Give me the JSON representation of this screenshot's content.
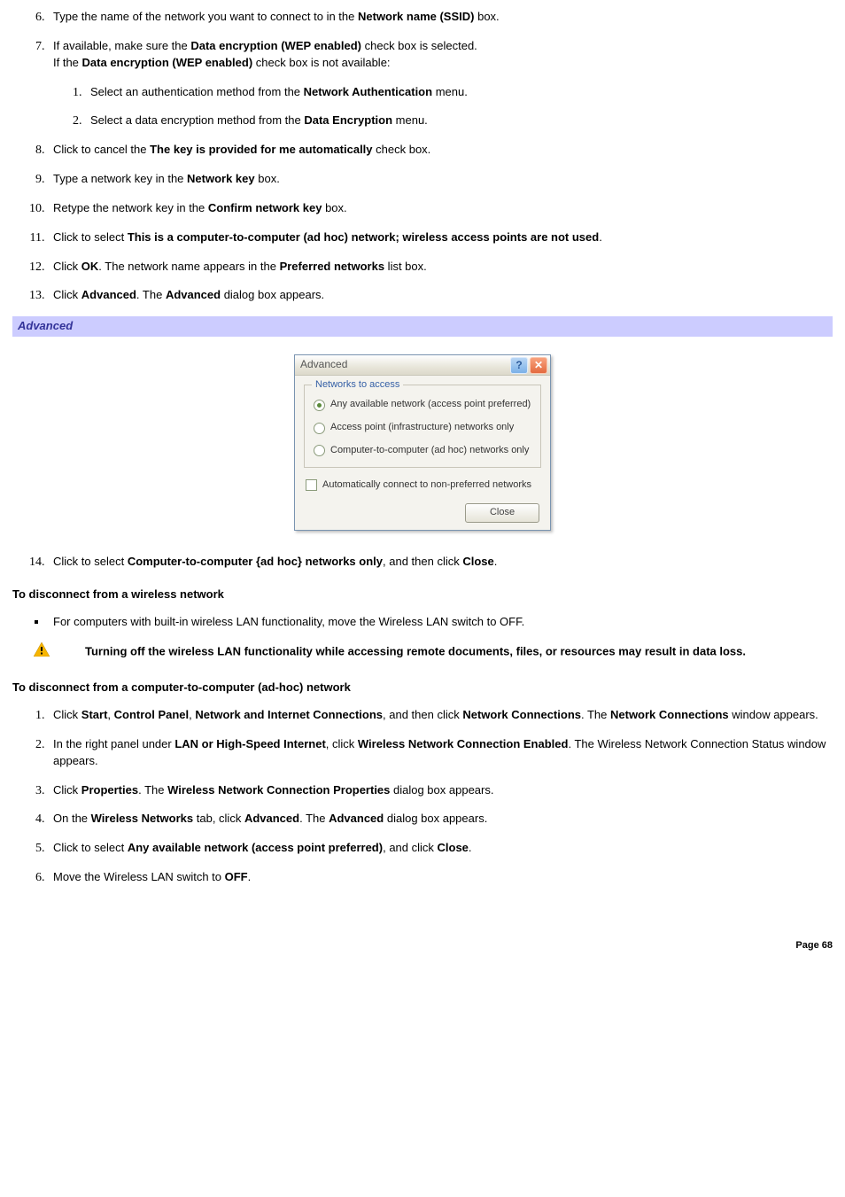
{
  "steps_a": {
    "6": {
      "pre": "Type the name of the network you want to connect to in the ",
      "b1": "Network name (SSID)",
      "post": " box."
    },
    "7": {
      "line1_pre": "If available, make sure the ",
      "line1_b": "Data encryption (WEP enabled)",
      "line1_post": " check box is selected.",
      "line2_pre": "If the ",
      "line2_b": "Data encryption (WEP enabled)",
      "line2_post": " check box is not available:",
      "sub": {
        "1": {
          "pre": "Select an authentication method from the ",
          "b": "Network Authentication",
          "post": " menu."
        },
        "2": {
          "pre": "Select a data encryption method from the ",
          "b": "Data Encryption",
          "post": " menu."
        }
      }
    },
    "8": {
      "pre": "Click to cancel the ",
      "b": "The key is provided for me automatically",
      "post": " check box."
    },
    "9": {
      "pre": "Type a network key in the ",
      "b": "Network key",
      "post": " box."
    },
    "10": {
      "pre": "Retype the network key in the ",
      "b": "Confirm network key",
      "post": " box."
    },
    "11": {
      "pre": "Click to select ",
      "b": "This is a computer-to-computer (ad hoc) network; wireless access points are not used",
      "post": "."
    },
    "12": {
      "pre": "Click ",
      "b1": "OK",
      "mid": ". The network name appears in the ",
      "b2": "Preferred networks",
      "post": " list box."
    },
    "13": {
      "pre": "Click ",
      "b1": "Advanced",
      "mid": ". The ",
      "b2": "Advanced",
      "post": " dialog box appears."
    },
    "14": {
      "pre": "Click to select ",
      "b1": "Computer-to-computer {ad hoc} networks only",
      "mid": ", and then click ",
      "b2": "Close",
      "post": "."
    }
  },
  "section_bar": "Advanced",
  "dialog": {
    "title": "Advanced",
    "group_legend": "Networks to access",
    "radios": [
      {
        "label": "Any available network (access point preferred)",
        "selected": true
      },
      {
        "label": "Access point (infrastructure) networks only",
        "selected": false
      },
      {
        "label": "Computer-to-computer (ad hoc) networks only",
        "selected": false
      }
    ],
    "checkbox_label": "Automatically connect to non-preferred networks",
    "close_btn": "Close"
  },
  "headings": {
    "disconnect_wireless": "To disconnect from a wireless network",
    "disconnect_adhoc": "To disconnect from a computer-to-computer (ad-hoc) network"
  },
  "bullet_off": "For computers with built-in wireless LAN functionality, move the Wireless LAN switch to OFF.",
  "warning": "Turning off the wireless LAN functionality while accessing remote documents, files, or resources may result in data loss.",
  "steps_b": {
    "1": {
      "pre": "Click ",
      "b1": "Start",
      "s1": ", ",
      "b2": "Control Panel",
      "s2": ", ",
      "b3": "Network and Internet Connections",
      "s3": ", and then click ",
      "b4": "Network Connections",
      "s4": ". The ",
      "b5": "Network Connections",
      "post": " window appears."
    },
    "2": {
      "pre": "In the right panel under ",
      "b1": "LAN or High-Speed Internet",
      "mid": ", click ",
      "b2": "Wireless Network Connection Enabled",
      "post": ". The Wireless Network Connection Status window appears."
    },
    "3": {
      "pre": "Click ",
      "b1": "Properties",
      "mid": ". The ",
      "b2": "Wireless Network Connection Properties",
      "post": " dialog box appears."
    },
    "4": {
      "pre": "On the ",
      "b1": "Wireless Networks",
      "mid1": " tab, click ",
      "b2": "Advanced",
      "mid2": ". The ",
      "b3": "Advanced",
      "post": " dialog box appears."
    },
    "5": {
      "pre": "Click to select ",
      "b1": "Any available network (access point preferred)",
      "mid": ", and click ",
      "b2": "Close",
      "post": "."
    },
    "6": {
      "pre": "Move the Wireless LAN switch to ",
      "b": "OFF",
      "post": "."
    }
  },
  "page_num": "Page 68"
}
